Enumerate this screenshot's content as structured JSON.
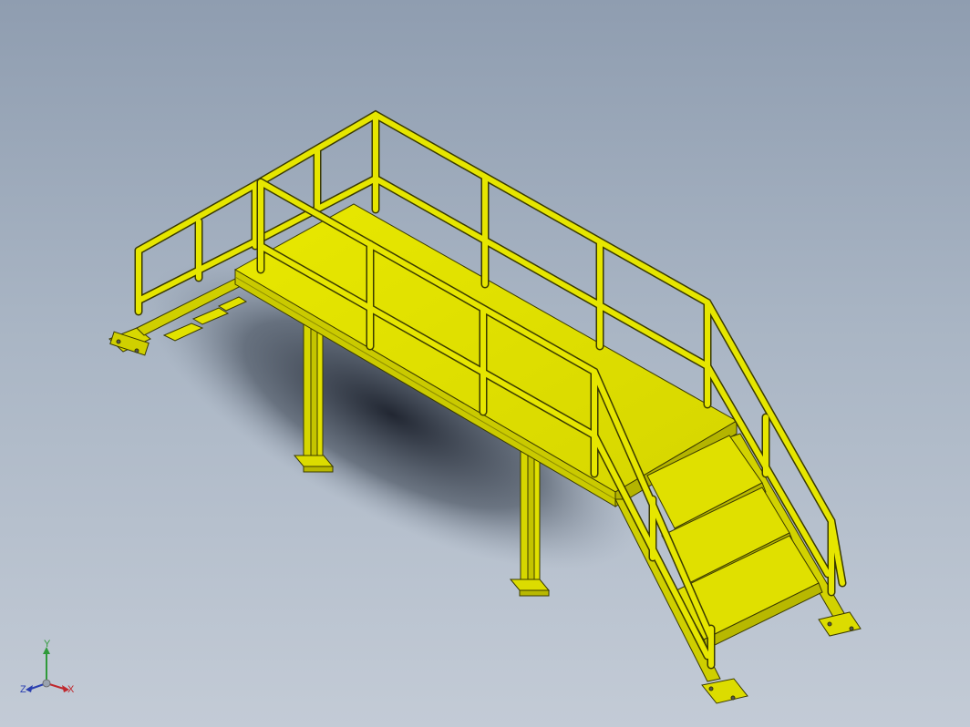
{
  "viewport": {
    "background_top": "#8f9db0",
    "background_bottom": "#c3cbd6"
  },
  "model": {
    "part_color": "#e6e600",
    "edge_color": "#3a3a00"
  },
  "triad": {
    "x_label": "X",
    "y_label": "Y",
    "z_label": "Z",
    "x_color": "#c0282d",
    "y_color": "#2f9a3a",
    "z_color": "#2a3fb0"
  }
}
